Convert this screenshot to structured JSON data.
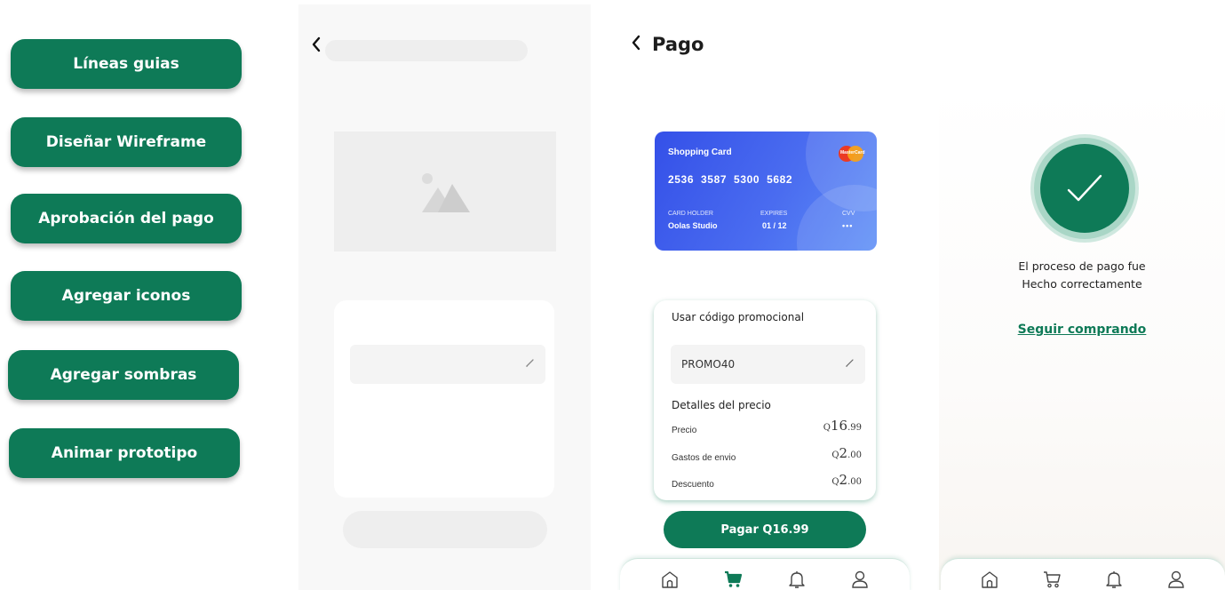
{
  "steps": [
    {
      "label": "Líneas guias"
    },
    {
      "label": "Diseñar Wireframe"
    },
    {
      "label": "Aprobación del pago"
    },
    {
      "label": "Agregar iconos"
    },
    {
      "label": "Agregar sombras"
    },
    {
      "label": "Animar prototipo"
    }
  ],
  "payment": {
    "title": "Pago",
    "card": {
      "name": "Shopping Card",
      "number": "2536 3587 5300 5682",
      "holder_label": "CARD HOLDER",
      "holder": "Oolas Studio",
      "expires_label": "EXPIRES",
      "expires": "01 / 12",
      "cvv_label": "CVV",
      "cvv": "•••",
      "brand": "MasterCard"
    },
    "promo": {
      "title": "Usar código promocional",
      "code": "PROMO40"
    },
    "details": {
      "title": "Detalles del precio",
      "rows": [
        {
          "label": "Precio",
          "currency": "Q",
          "amount": "16",
          "cents": ".99"
        },
        {
          "label": "Gastos de envio",
          "currency": "Q",
          "amount": "2",
          "cents": ".00"
        },
        {
          "label": "Descuento",
          "currency": "Q",
          "amount": "2",
          "cents": ".00"
        }
      ]
    },
    "pay_button": "Pagar Q16.99",
    "active_nav": "cart"
  },
  "success": {
    "message_line1": "El proceso de pago fue",
    "message_line2": "Hecho correctamente",
    "link": "Seguir comprando"
  },
  "nav_icons": [
    "home-icon",
    "cart-icon",
    "bell-icon",
    "user-icon"
  ],
  "colors": {
    "brand_green": "#0e7a57",
    "card_blue": "#3450e8",
    "wireframe_gray": "#eeeeee"
  }
}
